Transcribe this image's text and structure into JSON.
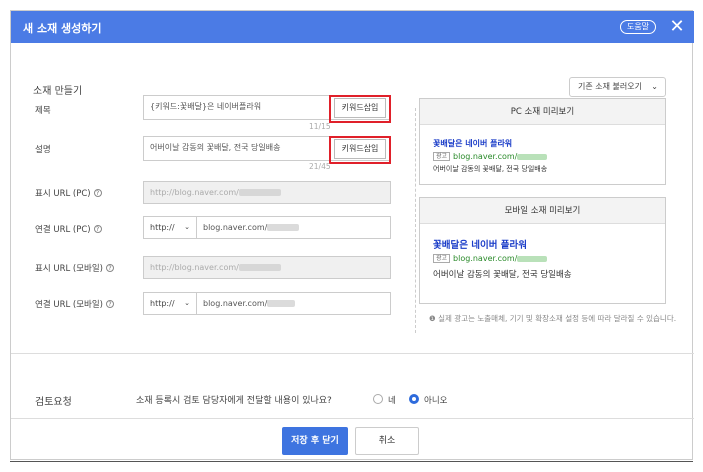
{
  "header": {
    "title": "새 소재 생성하기",
    "help_label": "도움말",
    "close_icon": "close-icon"
  },
  "section": {
    "title": "소재 만들기",
    "load_button": "기존 소재 불러오기"
  },
  "form": {
    "title": {
      "label": "제목",
      "value": "{키워드:꽃배달}은 네이버플라워",
      "counter": "11/15",
      "keyword_button": "키워드삽입"
    },
    "description": {
      "label": "설명",
      "value": "어버이날 감동의 꽃배달, 전국 당일배송",
      "counter": "21/45",
      "keyword_button": "키워드삽입"
    },
    "display_url_pc": {
      "label": "표시 URL (PC)",
      "value": "http://blog.naver.com/"
    },
    "link_url_pc": {
      "label": "연결 URL (PC)",
      "protocol": "http://",
      "value": "blog.naver.com/"
    },
    "display_url_mobile": {
      "label": "표시 URL (모바일)",
      "value": "http://blog.naver.com/"
    },
    "link_url_mobile": {
      "label": "연결 URL (모바일)",
      "protocol": "http://",
      "value": "blog.naver.com/"
    }
  },
  "preview_pc": {
    "header": "PC 소재 미리보기",
    "title": "꽃배달은 네이버 플라워",
    "ad_badge": "광고",
    "url": "blog.naver.com/",
    "description": "어버이날 감동의 꽃배달, 전국 당일배송"
  },
  "preview_mobile": {
    "header": "모바일 소재 미리보기",
    "title": "꽃배달은 네이버 플라워",
    "ad_badge": "광고",
    "url": "blog.naver.com/",
    "description": "어버이날 감동의 꽃배달, 전국 당일배송"
  },
  "note": "실제 광고는 노출매체, 기기 및 확장소재 설정 등에 따라 달라질 수 있습니다.",
  "review": {
    "title": "검토요청",
    "question": "소재 등록시 검토 담당자에게 전달할 내용이 있나요?",
    "option_yes": "네",
    "option_no": "아니오",
    "selected": "아니오"
  },
  "footer": {
    "save_button": "저장 후 닫기",
    "cancel_button": "취소"
  },
  "colors": {
    "header": "#4b7be5",
    "primary": "#3e74e0",
    "highlight": "#e0202a",
    "link_title": "#1a3cc8",
    "link_url": "#2a8a2a"
  }
}
